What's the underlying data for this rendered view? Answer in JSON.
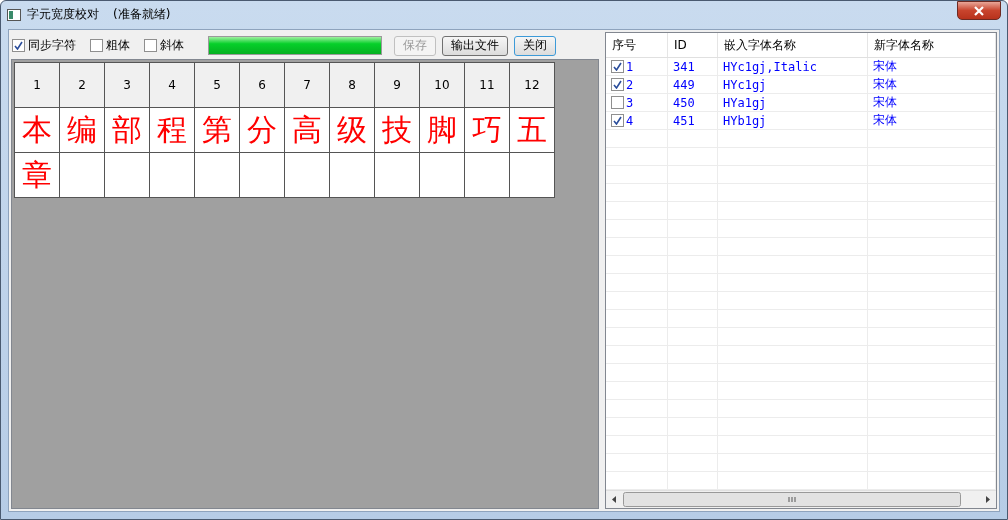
{
  "window": {
    "title": "字元宽度校对",
    "status": "(准备就绪)"
  },
  "toolbar": {
    "options": [
      {
        "label": "同步字符",
        "checked": true
      },
      {
        "label": "粗体",
        "checked": false
      },
      {
        "label": "斜体",
        "checked": false
      }
    ],
    "progress": {
      "level": 1
    },
    "buttons": [
      {
        "label": "保存",
        "disabled": true,
        "focused": false
      },
      {
        "label": "输出文件",
        "disabled": false,
        "focused": false
      },
      {
        "label": "关闭",
        "disabled": false,
        "focused": true
      }
    ]
  },
  "grid": {
    "columns": [
      "1",
      "2",
      "3",
      "4",
      "5",
      "6",
      "7",
      "8",
      "9",
      "10",
      "11",
      "12"
    ],
    "characters": [
      "本",
      "编",
      "部",
      "程",
      "第",
      "分",
      "高",
      "级",
      "技",
      "脚",
      "巧",
      "五",
      "章"
    ]
  },
  "table": {
    "columns": [
      "序号",
      "ID",
      "嵌入字体名称",
      "新字体名称"
    ],
    "rows": [
      {
        "checked": true,
        "number": "1",
        "id": "341",
        "embedded_font": "HYc1gj,Italic",
        "new_font": "宋体"
      },
      {
        "checked": true,
        "number": "2",
        "id": "449",
        "embedded_font": "HYc1gj",
        "new_font": "宋体"
      },
      {
        "checked": false,
        "number": "3",
        "id": "450",
        "embedded_font": "HYa1gj",
        "new_font": "宋体"
      },
      {
        "checked": true,
        "number": "4",
        "id": "451",
        "embedded_font": "HYb1gj",
        "new_font": "宋体"
      }
    ]
  }
}
